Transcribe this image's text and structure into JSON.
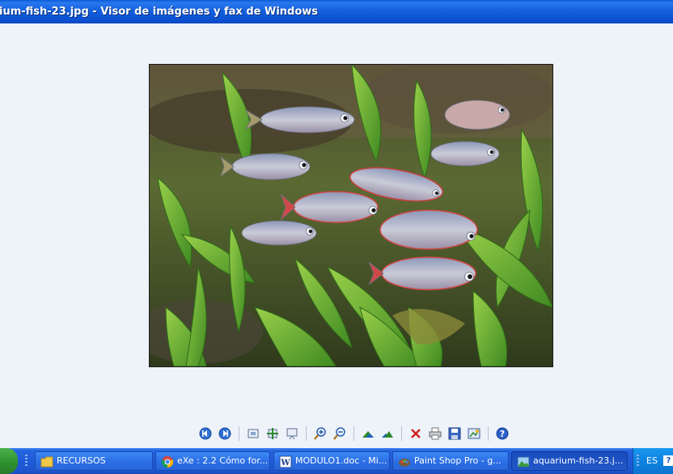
{
  "window": {
    "title": "ium-fish-23.jpg - Visor de imágenes y fax de Windows"
  },
  "toolbar": {
    "buttons": [
      {
        "name": "previous-image-button",
        "icon": "previous-image-icon"
      },
      {
        "name": "next-image-button",
        "icon": "next-image-icon"
      },
      {
        "name": "best-fit-button",
        "icon": "best-fit-icon"
      },
      {
        "name": "actual-size-button",
        "icon": "actual-size-icon"
      },
      {
        "name": "slideshow-button",
        "icon": "slideshow-icon"
      },
      {
        "name": "zoom-in-button",
        "icon": "zoom-in-icon"
      },
      {
        "name": "zoom-out-button",
        "icon": "zoom-out-icon"
      },
      {
        "name": "rotate-clockwise-button",
        "icon": "rotate-clockwise-icon"
      },
      {
        "name": "rotate-counterclockwise-button",
        "icon": "rotate-counterclockwise-icon"
      },
      {
        "name": "delete-button",
        "icon": "delete-icon"
      },
      {
        "name": "print-button",
        "icon": "print-icon"
      },
      {
        "name": "copy-to-button",
        "icon": "save-icon"
      },
      {
        "name": "open-for-editing-button",
        "icon": "edit-icon"
      },
      {
        "name": "help-button",
        "icon": "help-icon"
      }
    ]
  },
  "taskbar": {
    "items": [
      {
        "label": "RECURSOS",
        "icon": "folder-icon",
        "active": false
      },
      {
        "label": "eXe : 2.2 Cómo for...",
        "icon": "chrome-icon",
        "active": false
      },
      {
        "label": "MODULO1.doc - Mi...",
        "icon": "word-icon",
        "active": false
      },
      {
        "label": "Paint Shop Pro - g...",
        "icon": "paint-shop-pro-icon",
        "active": false
      },
      {
        "label": "aquarium-fish-23.j...",
        "icon": "image-viewer-icon",
        "active": true
      }
    ],
    "tray": {
      "language": "ES",
      "help_icon": "?"
    }
  },
  "colors": {
    "title_bar": "#0b4fd0",
    "viewer_background": "#eef3fa",
    "taskbar": "#1f5bd8",
    "tray": "#0e83e0"
  }
}
